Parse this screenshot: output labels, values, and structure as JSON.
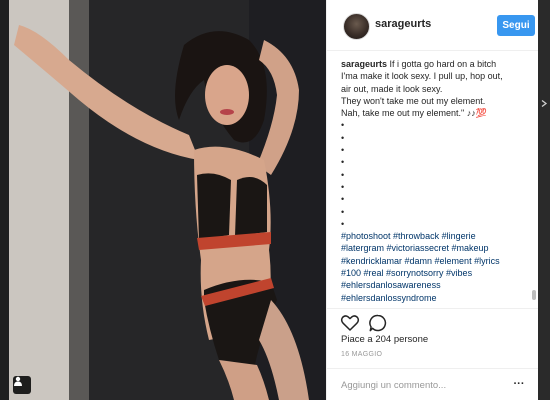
{
  "post": {
    "username": "sarageurts",
    "follow_label": "Segui",
    "caption_lines": [
      {
        "user": "sarageurts",
        "text": " If i gotta go hard on a bitch"
      },
      {
        "user": "",
        "text": "I'ma make it look sexy. I pull up, hop out,"
      },
      {
        "user": "",
        "text": "air out, made it look sexy."
      },
      {
        "user": "",
        "text": "They won't take me out my element."
      },
      {
        "user": "",
        "text": "Nah, take me out my element.\" ♪♪💯"
      }
    ],
    "bullets": [
      "•",
      "•",
      "•",
      "•",
      "•",
      "•",
      "•",
      "•",
      "•"
    ],
    "hashtag_lines": [
      "#photoshoot #throwback #lingerie",
      "#latergram #victoriassecret #makeup",
      "#kendricklamar #damn #element #lyrics",
      "#100 #real #sorrynotsorry #vibes",
      "#ehlersdanlosawareness",
      "#ehlersdanlossyndrome"
    ],
    "likes_text": "Piace a 204 persone",
    "date_text": "16 MAGGIO",
    "comment_placeholder": "Aggiungi un commento...",
    "more_label": "···"
  },
  "colors": {
    "accent": "#3897f0",
    "hashtag": "#003569",
    "text": "#262626",
    "muted": "#999999"
  },
  "icons": {
    "like": "heart-icon",
    "comment": "comment-icon",
    "user_tag": "user-tag-icon",
    "more": "more-options-icon",
    "next": "chevron-right-icon"
  }
}
